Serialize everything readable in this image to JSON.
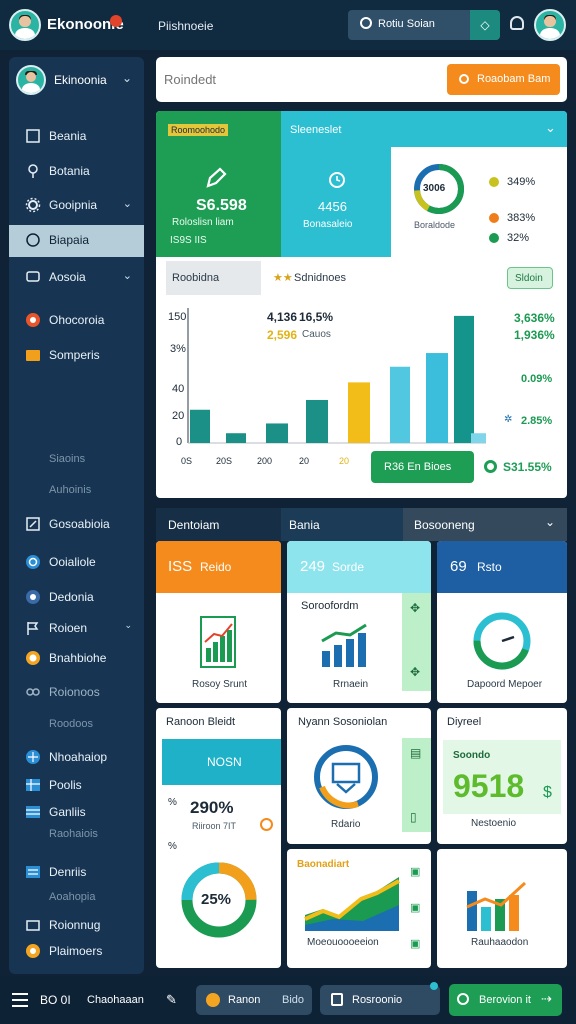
{
  "app": {
    "title": "Ekonoonie",
    "page_heading": "Piishnoeie"
  },
  "topbar": {
    "action_label": "Rotiu Soian"
  },
  "sidebar": {
    "profile_name": "Ekinoonia",
    "items": [
      {
        "label": "Beania"
      },
      {
        "label": "Botania"
      },
      {
        "label": "Gooipnia"
      },
      {
        "label": "Biapaia"
      },
      {
        "label": "Aosoia"
      },
      {
        "label": "Ohocoroia"
      },
      {
        "label": "Somperis"
      }
    ],
    "muted_1": "Siaoins",
    "muted_2": "Auhoinis",
    "items2": [
      {
        "label": "Gosoabioia"
      },
      {
        "label": "Ooialiole"
      },
      {
        "label": "Dedonia"
      },
      {
        "label": "Roioen"
      },
      {
        "label": "Bnahbiohe"
      },
      {
        "label": "Roionoos"
      }
    ],
    "muted_3": "Roodoos",
    "items3": [
      {
        "label": "Nhoahaiop"
      },
      {
        "label": "Poolis"
      },
      {
        "label": "Ganliis"
      }
    ],
    "muted_4": "Raohaiois",
    "items4": [
      {
        "label": "Denriis"
      }
    ],
    "muted_5": "Aoahopia",
    "items5": [
      {
        "label": "Roionnug"
      },
      {
        "label": "Plaimoers"
      }
    ]
  },
  "search": {
    "placeholder": "Roindedt",
    "button_label": "Roaobam Bam"
  },
  "summary": {
    "badge": "Roomoohodo",
    "tab_header": "Sleeneslet",
    "green_card": {
      "value": "S6.598",
      "caption": "Roloslisn liam",
      "sub": "IS9S IIS"
    },
    "teal_card": {
      "value": "4456",
      "caption": "Bonasaleio"
    },
    "donut": {
      "center": "3006",
      "caption": "Boraldode"
    },
    "legend": [
      {
        "value": "349%",
        "color": "#c8c21e"
      },
      {
        "value": "383%",
        "color": "#f07d1c"
      },
      {
        "value": "32%",
        "color": "#1b9a52"
      }
    ]
  },
  "chart_panel": {
    "tab1": "Roobidna",
    "tab2": "Sdnidnoes",
    "button": "Sldoin",
    "annot_top": "4,136",
    "annot_pct": "16,5%",
    "annot_yellow": "2,596",
    "annot_label": "Cauos",
    "right_1": "3,636%",
    "right_2": "1,936%",
    "right_3": "0.09%",
    "right_4": "2.85%",
    "bottom_button": "R36 En Bioes",
    "bottom_stat": "S31.55%",
    "bottom_icon": "circle-dot-icon"
  },
  "chart_data": {
    "type": "bar",
    "yticks": [
      "150",
      "3%",
      "40",
      "20",
      "0"
    ],
    "xticks": [
      "0S",
      "20S",
      "200",
      "20",
      "20"
    ],
    "values": [
      34,
      10,
      20,
      44,
      62,
      78,
      92,
      130,
      10
    ],
    "colors": [
      "#1a9086",
      "#1a9086",
      "#1a9086",
      "#1a9086",
      "#f2bd19",
      "#52c7e0",
      "#3bbedb",
      "#14948a",
      "#7fd5ea"
    ],
    "ylim": [
      0,
      135
    ]
  },
  "tabs2": {
    "t1": "Dentoiam",
    "t2": "Bania",
    "t3": "Bosooneng"
  },
  "tiles_row1": [
    {
      "header": "Reido",
      "num": "ISS",
      "caption": "Rosoy Srunt"
    },
    {
      "header": "Sorde",
      "num": "249",
      "title": "Soroofordm",
      "caption": "Rrnaein"
    },
    {
      "header": "Rsto",
      "num": "69",
      "caption": "Dapoord Mepoer"
    }
  ],
  "tiles_row2": [
    {
      "title": "Ranoon Bleidt",
      "banner": "NOSN",
      "pct": "290%",
      "sub": "Riiroon 7IT",
      "donut": "25%"
    },
    {
      "title": "Nyann Sosoniolan",
      "caption": "Rdario"
    },
    {
      "title": "Diyreel",
      "label": "Soondo",
      "big": "9518",
      "caption": "Nestoenio"
    }
  ],
  "tiles_row3": [
    {
      "title": "Baonadiart",
      "caption": "Moeouoooeeion"
    },
    {
      "caption": "Rauhaaodon"
    }
  ],
  "bottombar": {
    "text": "Chaohaaan",
    "code": "BO 0I",
    "pill1_label": "Ranon",
    "pill1_sub": "Bido",
    "pill2_label": "Rosroonio",
    "pill3_label": "Berovion it"
  }
}
